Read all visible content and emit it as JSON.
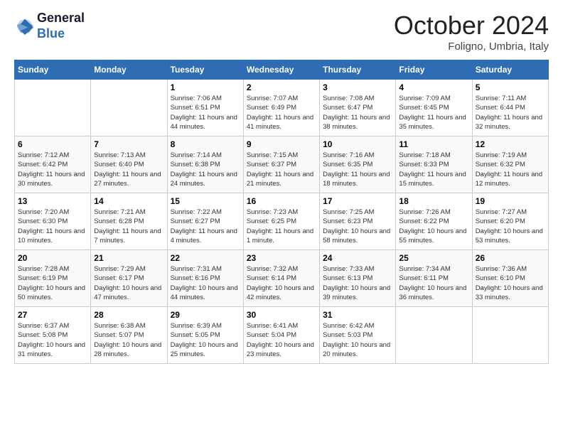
{
  "header": {
    "logo_line1": "General",
    "logo_line2": "Blue",
    "month": "October 2024",
    "location": "Foligno, Umbria, Italy"
  },
  "weekdays": [
    "Sunday",
    "Monday",
    "Tuesday",
    "Wednesday",
    "Thursday",
    "Friday",
    "Saturday"
  ],
  "weeks": [
    [
      {
        "day": "",
        "sunrise": "",
        "sunset": "",
        "daylight": ""
      },
      {
        "day": "",
        "sunrise": "",
        "sunset": "",
        "daylight": ""
      },
      {
        "day": "1",
        "sunrise": "Sunrise: 7:06 AM",
        "sunset": "Sunset: 6:51 PM",
        "daylight": "Daylight: 11 hours and 44 minutes."
      },
      {
        "day": "2",
        "sunrise": "Sunrise: 7:07 AM",
        "sunset": "Sunset: 6:49 PM",
        "daylight": "Daylight: 11 hours and 41 minutes."
      },
      {
        "day": "3",
        "sunrise": "Sunrise: 7:08 AM",
        "sunset": "Sunset: 6:47 PM",
        "daylight": "Daylight: 11 hours and 38 minutes."
      },
      {
        "day": "4",
        "sunrise": "Sunrise: 7:09 AM",
        "sunset": "Sunset: 6:45 PM",
        "daylight": "Daylight: 11 hours and 35 minutes."
      },
      {
        "day": "5",
        "sunrise": "Sunrise: 7:11 AM",
        "sunset": "Sunset: 6:44 PM",
        "daylight": "Daylight: 11 hours and 32 minutes."
      }
    ],
    [
      {
        "day": "6",
        "sunrise": "Sunrise: 7:12 AM",
        "sunset": "Sunset: 6:42 PM",
        "daylight": "Daylight: 11 hours and 30 minutes."
      },
      {
        "day": "7",
        "sunrise": "Sunrise: 7:13 AM",
        "sunset": "Sunset: 6:40 PM",
        "daylight": "Daylight: 11 hours and 27 minutes."
      },
      {
        "day": "8",
        "sunrise": "Sunrise: 7:14 AM",
        "sunset": "Sunset: 6:38 PM",
        "daylight": "Daylight: 11 hours and 24 minutes."
      },
      {
        "day": "9",
        "sunrise": "Sunrise: 7:15 AM",
        "sunset": "Sunset: 6:37 PM",
        "daylight": "Daylight: 11 hours and 21 minutes."
      },
      {
        "day": "10",
        "sunrise": "Sunrise: 7:16 AM",
        "sunset": "Sunset: 6:35 PM",
        "daylight": "Daylight: 11 hours and 18 minutes."
      },
      {
        "day": "11",
        "sunrise": "Sunrise: 7:18 AM",
        "sunset": "Sunset: 6:33 PM",
        "daylight": "Daylight: 11 hours and 15 minutes."
      },
      {
        "day": "12",
        "sunrise": "Sunrise: 7:19 AM",
        "sunset": "Sunset: 6:32 PM",
        "daylight": "Daylight: 11 hours and 12 minutes."
      }
    ],
    [
      {
        "day": "13",
        "sunrise": "Sunrise: 7:20 AM",
        "sunset": "Sunset: 6:30 PM",
        "daylight": "Daylight: 11 hours and 10 minutes."
      },
      {
        "day": "14",
        "sunrise": "Sunrise: 7:21 AM",
        "sunset": "Sunset: 6:28 PM",
        "daylight": "Daylight: 11 hours and 7 minutes."
      },
      {
        "day": "15",
        "sunrise": "Sunrise: 7:22 AM",
        "sunset": "Sunset: 6:27 PM",
        "daylight": "Daylight: 11 hours and 4 minutes."
      },
      {
        "day": "16",
        "sunrise": "Sunrise: 7:23 AM",
        "sunset": "Sunset: 6:25 PM",
        "daylight": "Daylight: 11 hours and 1 minute."
      },
      {
        "day": "17",
        "sunrise": "Sunrise: 7:25 AM",
        "sunset": "Sunset: 6:23 PM",
        "daylight": "Daylight: 10 hours and 58 minutes."
      },
      {
        "day": "18",
        "sunrise": "Sunrise: 7:26 AM",
        "sunset": "Sunset: 6:22 PM",
        "daylight": "Daylight: 10 hours and 55 minutes."
      },
      {
        "day": "19",
        "sunrise": "Sunrise: 7:27 AM",
        "sunset": "Sunset: 6:20 PM",
        "daylight": "Daylight: 10 hours and 53 minutes."
      }
    ],
    [
      {
        "day": "20",
        "sunrise": "Sunrise: 7:28 AM",
        "sunset": "Sunset: 6:19 PM",
        "daylight": "Daylight: 10 hours and 50 minutes."
      },
      {
        "day": "21",
        "sunrise": "Sunrise: 7:29 AM",
        "sunset": "Sunset: 6:17 PM",
        "daylight": "Daylight: 10 hours and 47 minutes."
      },
      {
        "day": "22",
        "sunrise": "Sunrise: 7:31 AM",
        "sunset": "Sunset: 6:16 PM",
        "daylight": "Daylight: 10 hours and 44 minutes."
      },
      {
        "day": "23",
        "sunrise": "Sunrise: 7:32 AM",
        "sunset": "Sunset: 6:14 PM",
        "daylight": "Daylight: 10 hours and 42 minutes."
      },
      {
        "day": "24",
        "sunrise": "Sunrise: 7:33 AM",
        "sunset": "Sunset: 6:13 PM",
        "daylight": "Daylight: 10 hours and 39 minutes."
      },
      {
        "day": "25",
        "sunrise": "Sunrise: 7:34 AM",
        "sunset": "Sunset: 6:11 PM",
        "daylight": "Daylight: 10 hours and 36 minutes."
      },
      {
        "day": "26",
        "sunrise": "Sunrise: 7:36 AM",
        "sunset": "Sunset: 6:10 PM",
        "daylight": "Daylight: 10 hours and 33 minutes."
      }
    ],
    [
      {
        "day": "27",
        "sunrise": "Sunrise: 6:37 AM",
        "sunset": "Sunset: 5:08 PM",
        "daylight": "Daylight: 10 hours and 31 minutes."
      },
      {
        "day": "28",
        "sunrise": "Sunrise: 6:38 AM",
        "sunset": "Sunset: 5:07 PM",
        "daylight": "Daylight: 10 hours and 28 minutes."
      },
      {
        "day": "29",
        "sunrise": "Sunrise: 6:39 AM",
        "sunset": "Sunset: 5:05 PM",
        "daylight": "Daylight: 10 hours and 25 minutes."
      },
      {
        "day": "30",
        "sunrise": "Sunrise: 6:41 AM",
        "sunset": "Sunset: 5:04 PM",
        "daylight": "Daylight: 10 hours and 23 minutes."
      },
      {
        "day": "31",
        "sunrise": "Sunrise: 6:42 AM",
        "sunset": "Sunset: 5:03 PM",
        "daylight": "Daylight: 10 hours and 20 minutes."
      },
      {
        "day": "",
        "sunrise": "",
        "sunset": "",
        "daylight": ""
      },
      {
        "day": "",
        "sunrise": "",
        "sunset": "",
        "daylight": ""
      }
    ]
  ]
}
